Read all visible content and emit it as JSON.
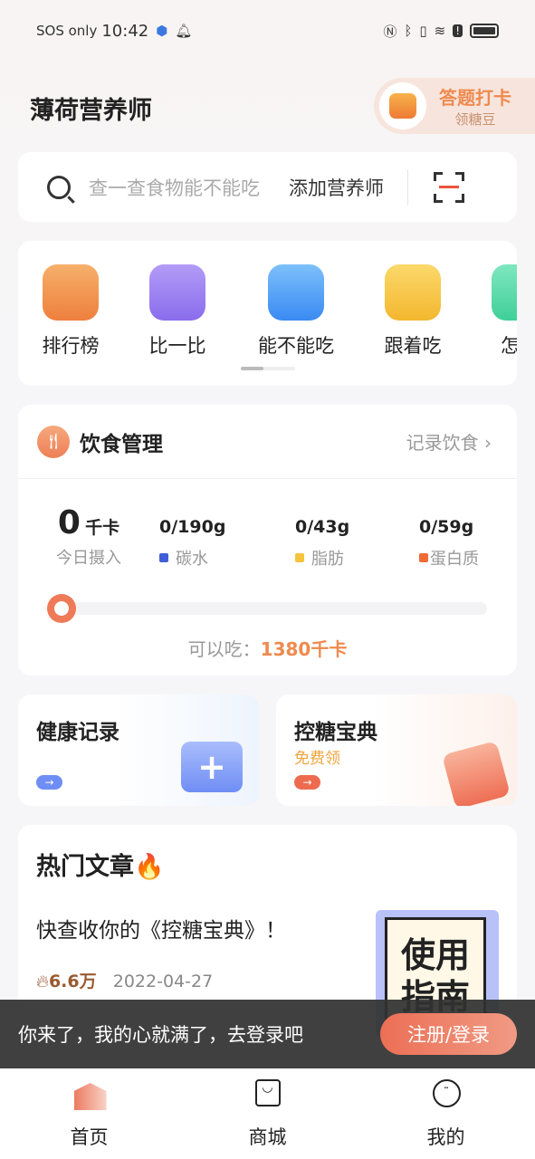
{
  "status": {
    "carrier": "SOS only",
    "time": "10:42",
    "icons": [
      "shield-icon",
      "bell-icon",
      "nfc-icon",
      "bluetooth-icon",
      "vibrate-icon",
      "wifi-icon",
      "alert-icon",
      "battery-icon"
    ]
  },
  "header": {
    "title": "薄荷营养师",
    "checkin_title": "答题打卡",
    "checkin_sub": "领糖豆"
  },
  "search": {
    "placeholder": "查一查食物能不能吃",
    "add_label": "添加营养师"
  },
  "quick": {
    "items": [
      {
        "label": "排行榜",
        "color": "#f0924c"
      },
      {
        "label": "比一比",
        "color": "#9b7ef0"
      },
      {
        "label": "能不能吃",
        "color": "#4d9cf5"
      },
      {
        "label": "跟着吃",
        "color": "#f6c33e"
      },
      {
        "label": "怎么",
        "color": "#4dd3a0"
      }
    ]
  },
  "diet": {
    "title": "饮食管理",
    "record": "记录饮食",
    "kcal": "0",
    "kcal_unit": "千卡",
    "kcal_label": "今日摄入",
    "macros": [
      {
        "value": "0/190g",
        "label": "碳水",
        "color": "#3f5fd8"
      },
      {
        "value": "0/43g",
        "label": "脂肪",
        "color": "#f5c33b"
      },
      {
        "value": "0/59g",
        "label": "蛋白质",
        "color": "#ee6b35"
      }
    ],
    "progress": 0,
    "can_eat_label": "可以吃：",
    "can_eat_value": "1380千卡"
  },
  "cards": [
    {
      "title": "健康记录",
      "arrow": "→",
      "color": "#6f8ef5"
    },
    {
      "title": "控糖宝典",
      "subtitle": "免费领",
      "arrow": "→",
      "color": "#ee6b4f"
    }
  ],
  "hot": {
    "title": "热门文章",
    "article": "快查收你的《控糖宝典》！",
    "thumb_text": "使用指南",
    "views": "6.6万",
    "date": "2022-04-27"
  },
  "login": {
    "message": "你来了，我的心就满了，去登录吧",
    "button": "注册/登录"
  },
  "tabs": [
    {
      "label": "首页"
    },
    {
      "label": "商城"
    },
    {
      "label": "我的"
    }
  ]
}
